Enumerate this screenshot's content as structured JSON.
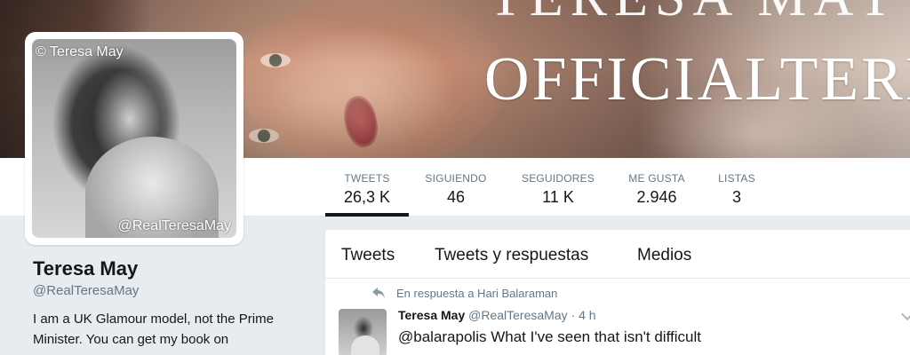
{
  "banner": {
    "title_top": "TERESA MAY",
    "title": "OFFICIALTERE"
  },
  "avatar": {
    "watermark_top": "© Teresa May",
    "watermark_bottom": "@RealTeresaMay"
  },
  "stats": [
    {
      "label": "TWEETS",
      "value": "26,3 K"
    },
    {
      "label": "SIGUIENDO",
      "value": "46"
    },
    {
      "label": "SEGUIDORES",
      "value": "11 K"
    },
    {
      "label": "ME GUSTA",
      "value": "2.946"
    },
    {
      "label": "LISTAS",
      "value": "3"
    }
  ],
  "profile": {
    "name": "Teresa May",
    "handle": "@RealTeresaMay",
    "bio": "I am a UK Glamour model, not the Prime Minister. You can get my book on"
  },
  "tabs": [
    "Tweets",
    "Tweets y respuestas",
    "Medios"
  ],
  "tweet": {
    "reply_context": "En respuesta a Hari Balaraman",
    "name": "Teresa May",
    "handle": "@RealTeresaMay",
    "separator": "·",
    "time": "4 h",
    "text": "@balarapolis What I've seen that isn't difficult"
  },
  "colors": {
    "secondary_text": "#657786",
    "border": "#e1e8ed",
    "page_background": "#e6ecf0"
  },
  "icons": [
    "reply-icon",
    "caret-down-icon"
  ]
}
